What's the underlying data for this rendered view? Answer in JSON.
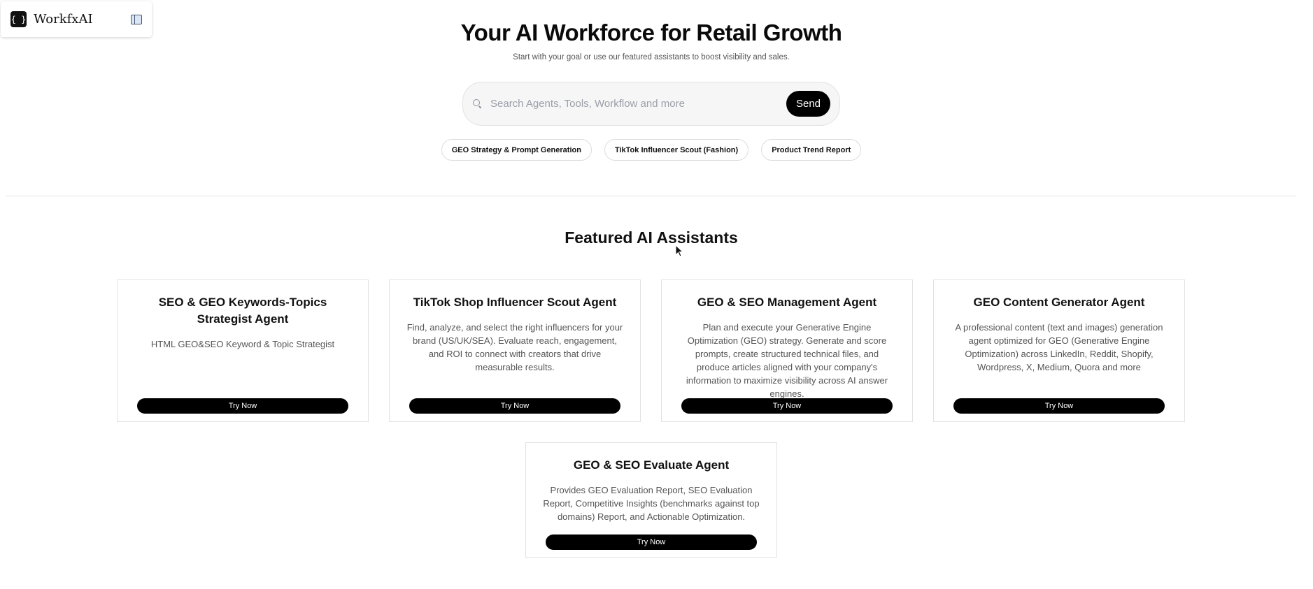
{
  "brand": {
    "logo_glyph": "{ }",
    "name": "WorkfxAI"
  },
  "hero": {
    "title": "Your AI Workforce for Retail Growth",
    "subtitle": "Start with your goal or use our featured assistants to boost visibility and sales."
  },
  "search": {
    "placeholder": "Search Agents, Tools, Workflow and more",
    "value": "",
    "send_label": "Send"
  },
  "chips": [
    "GEO Strategy & Prompt Generation",
    "TikTok Influencer Scout (Fashion)",
    "Product Trend Report"
  ],
  "featured": {
    "title": "Featured AI Assistants",
    "cards": [
      {
        "title": "SEO & GEO Keywords-Topics Strategist Agent",
        "description": "HTML GEO&SEO Keyword & Topic Strategist",
        "button": "Try Now"
      },
      {
        "title": "TikTok Shop Influencer Scout Agent",
        "description": "Find, analyze, and select the right influencers for your brand (US/UK/SEA). Evaluate reach, engagement, and ROI to connect with creators that drive measurable results.",
        "button": "Try Now"
      },
      {
        "title": "GEO & SEO Management Agent",
        "description": "Plan and execute your Generative Engine Optimization (GEO) strategy. Generate and score prompts, create structured technical files, and produce articles aligned with your company's information to maximize visibility across AI answer engines.",
        "button": "Try Now"
      },
      {
        "title": "GEO Content Generator Agent",
        "description": "A professional content (text and images) generation agent optimized for GEO (Generative Engine Optimization) across LinkedIn, Reddit, Shopify, Wordpress, X, Medium, Quora and more",
        "button": "Try Now"
      },
      {
        "title": "GEO & SEO Evaluate Agent",
        "description": "Provides GEO Evaluation Report, SEO Evaluation Report, Competitive Insights (benchmarks against top domains) Report, and Actionable Optimization.",
        "button": "Try Now"
      }
    ]
  },
  "icons": {
    "logo": "code-braces-icon",
    "sidebar_toggle": "sidebar-toggle-icon",
    "search": "search-icon",
    "cursor": "mouse-pointer-icon"
  },
  "colors": {
    "accent": "#000000",
    "background": "#ffffff",
    "toggle_fill": "#dbe6f7"
  }
}
